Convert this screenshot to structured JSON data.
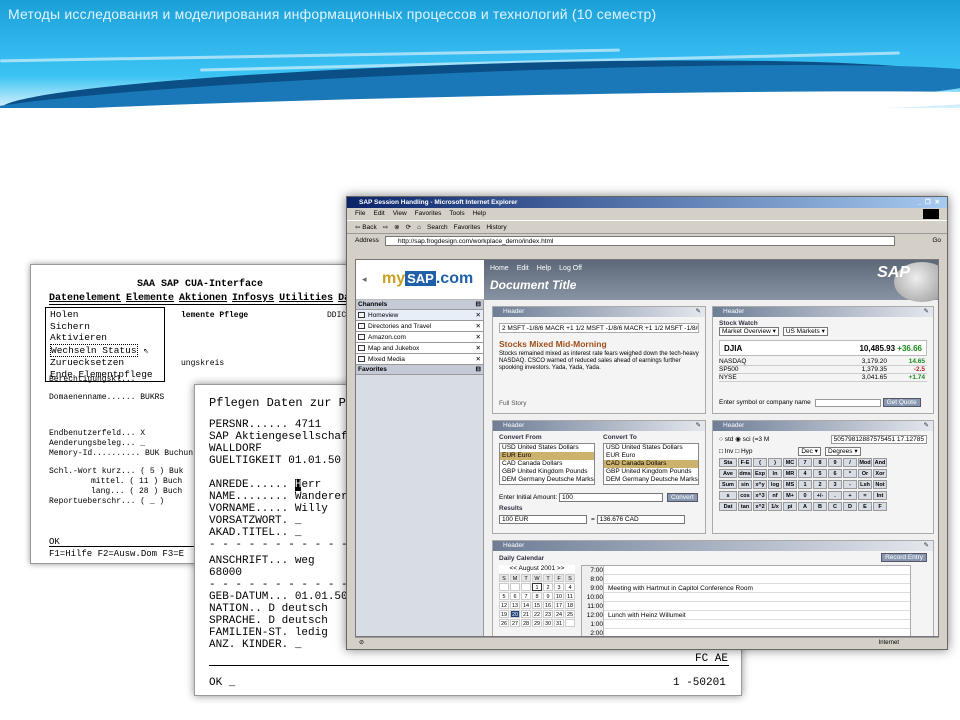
{
  "slide_title": "Методы исследования и моделирования информационных процессов и технологий (10 семестр)",
  "sapgui": {
    "window_title": "SAA SAP CUA-Interface",
    "menu": [
      "Datenelement",
      "Elemente",
      "Aktionen",
      "Infosys",
      "Utilities",
      "Dasis",
      "S"
    ],
    "dropdown": [
      "Holen",
      "Sichern",
      "Aktivieren",
      "Wechseln Status",
      "Zuruecksetzen",
      "Ende Elementpflege"
    ],
    "subtitle": "lemente Pflege",
    "code": "DDIC",
    "rows": [
      "ungskreis",
      "Berechtigungskl... _",
      "Domaenenname...... BUKRS",
      "Endbenutzerfeld... X",
      "Aenderungsbeleg... _",
      "Memory-Id.......... BUK Buchun",
      "Schl.-Wort kurz... ( 5 ) Buk",
      "mittel. ( 11 ) Buch",
      "lang... ( 28 ) Buch",
      "Reportueberschr... ( _ )"
    ],
    "ok": "OK",
    "fkeys": "F1=Hilfe  F2=Ausw.Dom  F3=E"
  },
  "terminal": {
    "heading": "Pflegen Daten zur Per",
    "lines": [
      "PERSNR...... 4711",
      "SAP Aktiengesellschaf",
      "WALLDORF",
      "GUELTIGKEIT  01.01.50"
    ],
    "lines2": [
      "ANREDE......",
      "NAME........ Wanderer",
      "VORNAME..... Willy",
      "VORSATZWORT. _",
      "AKAD.TITEL.. _"
    ],
    "anrede_cursor": "H",
    "anrede_rest": "err",
    "dash": "- - - - - - - - - - - - -",
    "lines3": [
      "ANSCHRIFT... weg",
      "             68000"
    ],
    "lines4": [
      "GEB-DATUM... 01.01.50",
      "NATION.. D   deutsch",
      "SPRACHE. D   deutsch",
      "FAMILIEN-ST. ledig",
      "ANZ. KINDER. _"
    ],
    "fc": "FC AE",
    "ok": "OK _",
    "code": "1 -50201"
  },
  "browser": {
    "title": "SAP Session Handling - Microsoft Internet Explorer",
    "controls": "_ ❐ ✕",
    "menu": [
      "File",
      "Edit",
      "View",
      "Favorites",
      "Tools",
      "Help"
    ],
    "toolbar": [
      "⇦ Back",
      "⇨",
      "⊗",
      "⟳",
      "⌂",
      "Search",
      "Favorites",
      "History"
    ],
    "address_label": "Address",
    "url": "http://sap.frogdesign.com/workplace_demo/index.html",
    "go": "Go",
    "status": "Internet"
  },
  "portal": {
    "logo_my": "my",
    "logo_sap": "SAP",
    "logo_com": ".com",
    "nav": [
      "Home",
      "Edit",
      "Help",
      "Log Off"
    ],
    "doc_title": "Document Title",
    "sap_brand": "SAP",
    "channels_label": "Channels",
    "channels": [
      "Homeview",
      "Directories and Travel",
      "Amazon.com",
      "Map and Jukebox",
      "Mixed Media"
    ],
    "favorites_label": "Favorites",
    "header_label": "Header"
  },
  "news": {
    "ticker": "2  MSFT -1/8/6  MACR +1 1/2  MSFT -1/8/6 MACR +1 1/2  MSFT -1/8/6  M",
    "headline": "Stocks Mixed Mid-Morning",
    "body": "Stocks remained mixed as interest rate fears weighed down the tech-heavy NASDAQ. CSCO warned of reduced sales ahead of earnings further spooking investors. Yada, Yada, Yada.",
    "footer": "Full Story"
  },
  "stock": {
    "label": "Stock Watch",
    "select1": "Market Overview ▾",
    "select2": "US Markets ▾",
    "djia_name": "DJIA",
    "djia_val": "10,485.93",
    "djia_chg": "+36.66",
    "rows": [
      {
        "n": "NASDAQ",
        "v": "3,179.20",
        "c": "14.65",
        "neg": false
      },
      {
        "n": "SP500",
        "v": "1,379.35",
        "c": "-2.5",
        "neg": true
      },
      {
        "n": "NYSE",
        "v": "3,041.65",
        "c": "+1.74",
        "neg": false
      }
    ],
    "enter": "Enter symbol or company name",
    "btn": "Get Quote"
  },
  "convert": {
    "from_label": "Convert From",
    "to_label": "Convert To",
    "from": [
      "USD United States Dollars",
      "EUR Euro",
      "CAD Canada Dollars",
      "GBP United Kingdom Pounds",
      "DEM Germany Deutsche Marks"
    ],
    "to": [
      "USD United States Dollars",
      "EUR Euro",
      "CAD Canada Dollars",
      "GBP United Kingdom Pounds",
      "DEM Germany Deutsche Marks"
    ],
    "amount_label": "Enter Initial Amount:",
    "amount": "100",
    "btn": "Convert",
    "results_label": "Results",
    "r_from": "100 EUR",
    "r_eq": "=",
    "r_to": "136.676 CAD"
  },
  "calc": {
    "display": "50579812887575451 17.12785",
    "mode": "○ std  ◉ sci   (=3  M",
    "row1": "□ Inv  □ Hyp",
    "dec": "Dec ▾",
    "deg": "Degrees ▾",
    "keys": [
      [
        "Sta",
        "F-E",
        "(",
        ")",
        "MC",
        "7",
        "8",
        "9",
        "/",
        "Mod",
        "And"
      ],
      [
        "Ave",
        "dms",
        "Exp",
        "ln",
        "MR",
        "4",
        "5",
        "6",
        "*",
        "Or",
        "Xor"
      ],
      [
        "Sum",
        "sin",
        "x^y",
        "log",
        "MS",
        "1",
        "2",
        "3",
        "-",
        "Lsh",
        "Not"
      ],
      [
        "s",
        "cos",
        "x^3",
        "nf",
        "M+",
        "0",
        "+/-",
        ".",
        "+",
        "=",
        "Int"
      ],
      [
        "Dat",
        "tan",
        "x^2",
        "1/x",
        "pi",
        "A",
        "B",
        "C",
        "D",
        "E",
        "F"
      ]
    ]
  },
  "calendar": {
    "label": "Daily Calendar",
    "btn": "Record Entry",
    "month": "<<   August 2001   >>",
    "days": [
      "S",
      "M",
      "T",
      "W",
      "T",
      "F",
      "S"
    ],
    "dates": [
      "",
      "",
      "",
      "1",
      "2",
      "3",
      "4",
      "5",
      "6",
      "7",
      "8",
      "9",
      "10",
      "11",
      "12",
      "13",
      "14",
      "15",
      "16",
      "17",
      "18",
      "19",
      "20",
      "21",
      "22",
      "23",
      "24",
      "25",
      "26",
      "27",
      "28",
      "29",
      "30",
      "31",
      ""
    ],
    "slots": [
      {
        "t": "7:00",
        "e": ""
      },
      {
        "t": "8:00",
        "e": ""
      },
      {
        "t": "9:00",
        "e": "Meeting with Hartmut in Capitol Conference Room"
      },
      {
        "t": "10:00",
        "e": ""
      },
      {
        "t": "11:00",
        "e": ""
      },
      {
        "t": "12:00",
        "e": "Lunch with Heinz Willumeit"
      },
      {
        "t": "1:00",
        "e": ""
      },
      {
        "t": "2:00",
        "e": ""
      }
    ]
  }
}
